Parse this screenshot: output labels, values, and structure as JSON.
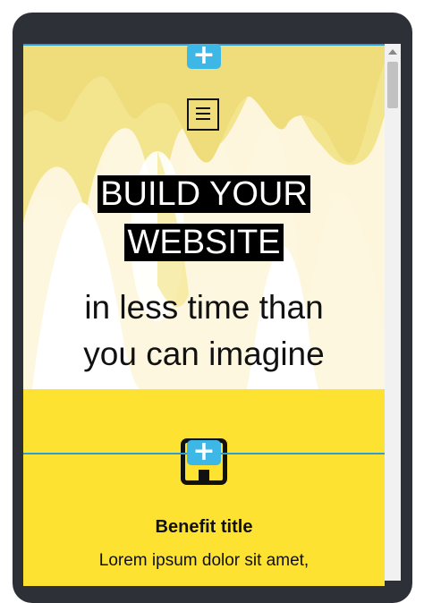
{
  "hero": {
    "title_line1": "BUILD YOUR",
    "title_line2": "WEBSITE",
    "subtitle_line1": "in less time than",
    "subtitle_line2": "you can imagine"
  },
  "benefit": {
    "title": "Benefit title",
    "text": "Lorem ipsum dolor sit amet,"
  },
  "editor": {
    "add_button_label": "+",
    "guide_color": "#2a9fd0",
    "add_button_color": "#3cb7e6"
  },
  "colors": {
    "frame": "#2d3036",
    "hero_yellow_light": "#fdf6dc",
    "hero_yellow": "#f3e58e",
    "hero_yellow_dark": "#eedb74",
    "benefit_bg": "#fde231"
  },
  "icons": {
    "menu": "hamburger-menu-icon",
    "benefit": "square-icon"
  }
}
